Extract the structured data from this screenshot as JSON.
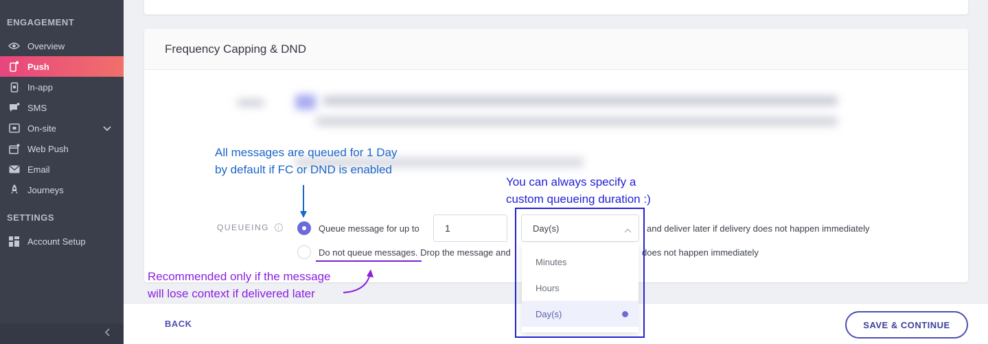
{
  "sidebar": {
    "engagement_title": "ENGAGEMENT",
    "settings_title": "SETTINGS",
    "items": [
      {
        "label": "Overview",
        "icon": "eye-icon"
      },
      {
        "label": "Push",
        "icon": "mobile-push-icon",
        "active": true
      },
      {
        "label": "In-app",
        "icon": "mobile-icon"
      },
      {
        "label": "SMS",
        "icon": "chat-icon"
      },
      {
        "label": "On-site",
        "icon": "window-icon",
        "expandable": true
      },
      {
        "label": "Web Push",
        "icon": "browser-icon"
      },
      {
        "label": "Email",
        "icon": "mail-icon"
      },
      {
        "label": "Journeys",
        "icon": "rocket-icon"
      }
    ],
    "settings_items": [
      {
        "label": "Account Setup",
        "icon": "grid-icon"
      }
    ]
  },
  "section": {
    "title": "Frequency Capping & DND"
  },
  "queueing": {
    "label": "QUEUEING",
    "option1_text": "Queue message for up to",
    "option1_suffix": "and deliver later if delivery does not happen immediately",
    "duration_value": "1",
    "unit_selected": "Day(s)",
    "unit_options": [
      "Minutes",
      "Hours",
      "Day(s)"
    ],
    "option2_text": "Do not queue messages.",
    "option2_text_rest": "Drop the message and",
    "option2_suffix": "does not happen immediately"
  },
  "footer": {
    "back_label": "BACK",
    "save_label": "SAVE & CONTINUE"
  },
  "annotations": {
    "default_queue_line1": "All messages are queued for 1 Day",
    "default_queue_line2": "by default if FC or DND is enabled",
    "custom_duration_line1": "You can always specify a",
    "custom_duration_line2": "custom queueing duration :)",
    "recommended_line1": "Recommended only if the message",
    "recommended_line2": "will lose context if delivered later"
  },
  "colors": {
    "sidebar_bg": "#3b3f4c",
    "active_gradient_start": "#e8457e",
    "active_gradient_end": "#f0706a",
    "accent": "#6a6bd8",
    "annotation_blue": "#1a66c8",
    "annotation_navy": "#1f1fd6",
    "annotation_purple": "#8a1fe0"
  }
}
